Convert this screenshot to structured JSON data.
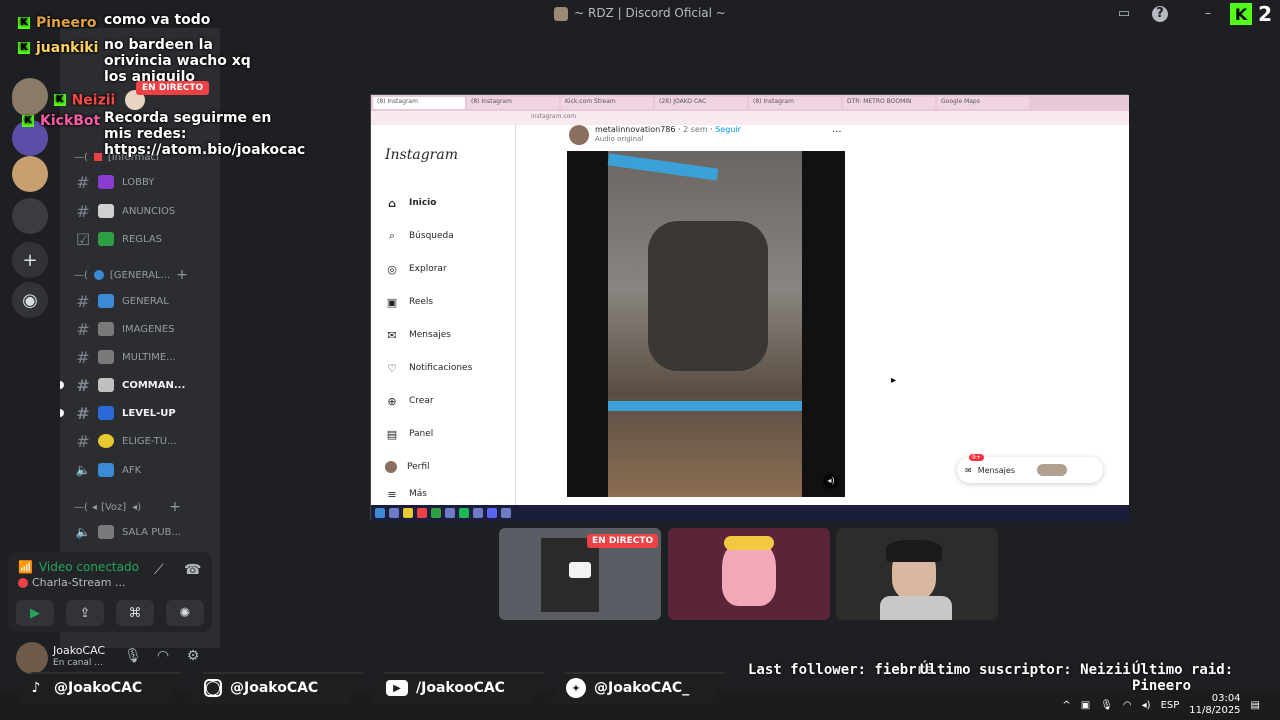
{
  "window": {
    "title": "~ RDZ | Discord Oficial ~",
    "kick_viewers": "2"
  },
  "chat": [
    {
      "user": "Pineero",
      "message": "como va todo",
      "user_color": "#e3a33b"
    },
    {
      "user": "juankiki",
      "message": "no bardeen la orivincia wacho xq los aniquilo",
      "user_color": "#ffd35a"
    },
    {
      "user": "Neizii",
      "message": "",
      "user_color": "#ff4a4a"
    },
    {
      "user": "KickBot",
      "message": "Recorda seguirme en mis redes: https://atom.bio/joakocac",
      "user_color": "#ff5aa8"
    }
  ],
  "live_badge": "EN DIRECTO",
  "channels": [
    {
      "name": "LOBBY",
      "icon_color": "#8a3cd0",
      "type": "text"
    },
    {
      "name": "ANUNCIOS",
      "icon_color": "#d0d0d0",
      "type": "text"
    },
    {
      "name": "REGLAS",
      "icon_color": "#2ea043",
      "type": "rules"
    },
    {
      "name": "GENERAL",
      "icon_color": "#3a8ad8",
      "type": "text"
    },
    {
      "name": "IMAGENES",
      "icon_color": "#7a7a7a",
      "type": "text"
    },
    {
      "name": "MULTIME...",
      "icon_color": "#7a7a7a",
      "type": "text"
    },
    {
      "name": "COMMAN...",
      "icon_color": "#c0c0c0",
      "type": "text",
      "unread": true
    },
    {
      "name": "LEVEL-UP",
      "icon_color": "#2a6ad8",
      "type": "text",
      "unread": true
    },
    {
      "name": "ELIGE-TU...",
      "icon_color": "#e8c830",
      "type": "text"
    },
    {
      "name": "AFK",
      "icon_color": "#3a8ad8",
      "type": "voice"
    },
    {
      "name": "SALA PUB...",
      "icon_color": "#7a7a7a",
      "type": "voice"
    }
  ],
  "categories": {
    "informacion": "[Informaci",
    "general": "[GENERAL...",
    "voz": "[Voz]"
  },
  "voice": {
    "status": "Video conectado",
    "channel": "Charla-Stream ..."
  },
  "user": {
    "name": "JoakoCAC",
    "status": "En canal ..."
  },
  "instagram": {
    "logo": "Instagram",
    "nav": [
      "Inicio",
      "Búsqueda",
      "Explorar",
      "Reels",
      "Mensajes",
      "Notificaciones",
      "Crear",
      "Panel",
      "Perfil",
      "Más"
    ],
    "author": "metalinnovation786",
    "age": "2 sem",
    "follow": "Seguir",
    "sound": "Audio original",
    "messages_label": "Mensajes",
    "messages_badge": "9+",
    "address": "instagram.com"
  },
  "browser_tabs": [
    "(8) Instagram",
    "(8) Instagram",
    "Kick.com Stream",
    "(28) JOAKO CAC",
    "(8) Instagram",
    "DTR: METRO BOOMIN",
    "Google Maps"
  ],
  "stream_stats": {
    "last_follower": "Last follower: fiebrre",
    "last_sub": "Último suscriptor: Neizii",
    "last_raid": "Último raid: Pineero"
  },
  "socials": [
    {
      "network": "tiktok",
      "handle": "@JoakoCAC"
    },
    {
      "network": "instagram",
      "handle": "@JoakoCAC"
    },
    {
      "network": "youtube",
      "handle": "/JoakooCAC"
    },
    {
      "network": "twitter",
      "handle": "@JoakoCAC_"
    }
  ],
  "tray": {
    "lang": "ESP",
    "time": "03:04",
    "date": "11/8/2025"
  }
}
